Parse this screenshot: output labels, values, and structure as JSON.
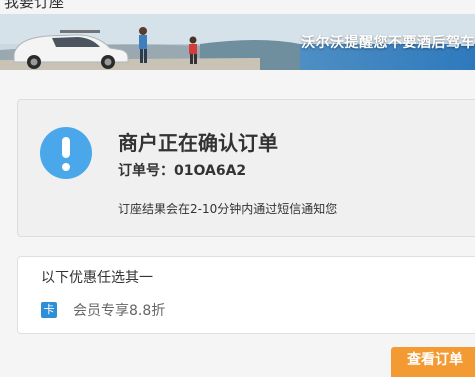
{
  "page": {
    "title": "我要订座"
  },
  "banner": {
    "slogan": "沃尔沃提醒您不要酒后驾车"
  },
  "status": {
    "icon": "exclamation-circle-icon",
    "title": "商户正在确认订单",
    "order_label": "订单号：",
    "order_number": "01OA6A2",
    "note": "订座结果会在2-10分钟内通过短信通知您"
  },
  "offers": {
    "title": "以下优惠任选其一",
    "items": [
      {
        "badge": "卡",
        "label": "会员专享8.8折"
      }
    ]
  },
  "actions": {
    "view_order": "查看订单"
  },
  "colors": {
    "accent_blue": "#4aa8ea",
    "badge_blue": "#2f8fd6",
    "button_orange": "#f39a32"
  }
}
